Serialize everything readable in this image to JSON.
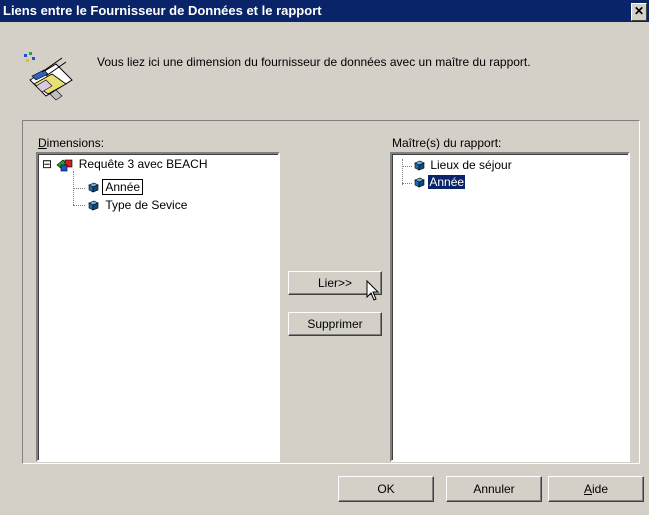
{
  "window": {
    "title": "Liens entre le Fournisseur de Données et le  rapport",
    "close_glyph": "✕"
  },
  "intro_text": "Vous liez ici une dimension du fournisseur de données avec un maître du rapport.",
  "dimensions": {
    "label_accel": "D",
    "label_rest": "imensions:",
    "root": "Requête 3 avec BEACH",
    "root_expander": "⊟",
    "children": [
      "Année",
      "Type de Sevice"
    ]
  },
  "masters": {
    "label": "Maître(s) du rapport:",
    "items": [
      "Lieux de séjour",
      "Année"
    ]
  },
  "buttons": {
    "link": "Lier>>",
    "delete": "Supprimer",
    "ok": "OK",
    "cancel": "Annuler",
    "help_accel": "A",
    "help_rest": "ide"
  },
  "colors": {
    "titlebar": "#0a246a",
    "selection": "#0a246a",
    "dialog_bg": "#d4d0c8",
    "cube": "#1a6fb0"
  },
  "icons": [
    "wizard-illustration-icon",
    "query-cube-icon",
    "dimension-icon",
    "close-icon",
    "mouse-cursor-icon"
  ]
}
